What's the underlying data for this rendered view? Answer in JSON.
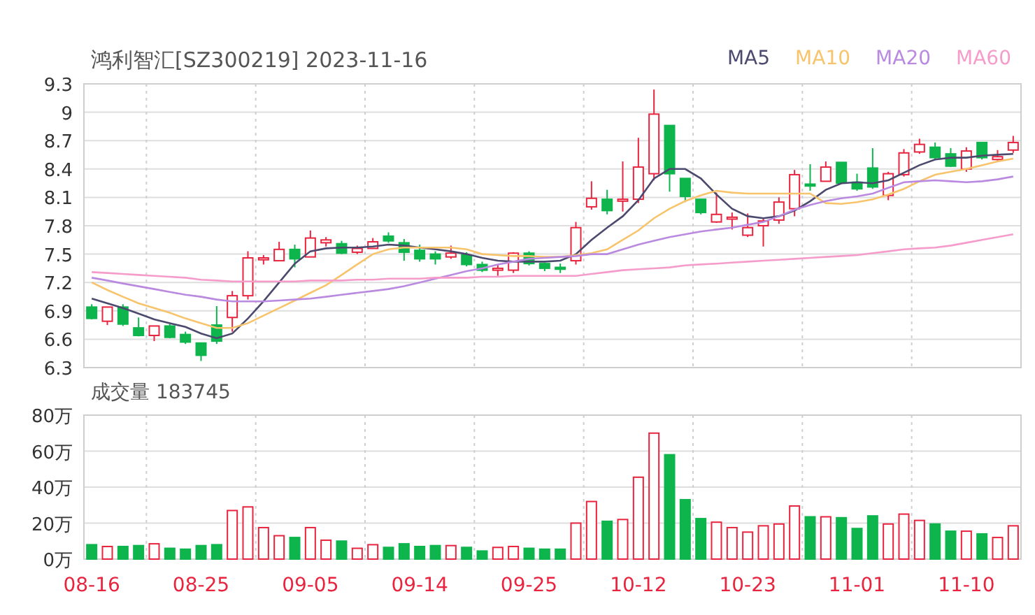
{
  "price_chart": {
    "chart_data": {
      "type": "candlestick",
      "title": "鸿利智汇[SZ300219] 2023-11-16",
      "grid": true,
      "ylim": [
        6.3,
        9.3
      ],
      "yticks": [
        {
          "value": 9.3,
          "label": "9.3"
        },
        {
          "value": 9,
          "label": "9"
        },
        {
          "value": 8.7,
          "label": "8.7"
        },
        {
          "value": 8.4,
          "label": "8.4"
        },
        {
          "value": 8.1,
          "label": "8.1"
        },
        {
          "value": 7.8,
          "label": "7.8"
        },
        {
          "value": 7.5,
          "label": "7.5"
        },
        {
          "value": 7.2,
          "label": "7.2"
        },
        {
          "value": 6.9,
          "label": "6.9"
        },
        {
          "value": 6.6,
          "label": "6.6"
        },
        {
          "value": 6.3,
          "label": "6.3"
        }
      ],
      "categories": [
        null,
        null,
        null,
        null,
        null,
        null,
        null,
        null,
        null,
        null,
        null,
        null,
        null,
        null,
        null,
        null,
        null,
        null,
        null,
        null,
        null,
        null,
        null,
        null,
        null,
        null,
        null,
        null,
        null,
        null,
        null,
        null,
        null,
        null,
        null,
        null,
        null,
        null,
        null,
        null,
        null,
        null,
        null,
        null,
        null,
        null,
        null,
        null,
        null,
        null,
        null,
        null,
        null,
        null,
        null,
        null,
        null,
        null,
        null,
        null
      ],
      "ohlc": [
        [
          6.94,
          6.97,
          6.81,
          6.82
        ],
        [
          6.79,
          6.94,
          6.75,
          6.94
        ],
        [
          6.94,
          6.97,
          6.74,
          6.76
        ],
        [
          6.72,
          6.83,
          6.63,
          6.64
        ],
        [
          6.64,
          6.74,
          6.58,
          6.74
        ],
        [
          6.74,
          6.76,
          6.61,
          6.62
        ],
        [
          6.65,
          6.68,
          6.55,
          6.57
        ],
        [
          6.56,
          6.56,
          6.37,
          6.43
        ],
        [
          6.75,
          6.95,
          6.55,
          6.58
        ],
        [
          6.83,
          7.11,
          6.68,
          7.06
        ],
        [
          7.06,
          7.53,
          7.02,
          7.46
        ],
        [
          7.44,
          7.49,
          7.39,
          7.46
        ],
        [
          7.43,
          7.63,
          7.43,
          7.55
        ],
        [
          7.55,
          7.6,
          7.36,
          7.45
        ],
        [
          7.47,
          7.75,
          7.47,
          7.67
        ],
        [
          7.62,
          7.68,
          7.58,
          7.65
        ],
        [
          7.61,
          7.64,
          7.5,
          7.51
        ],
        [
          7.52,
          7.59,
          7.5,
          7.56
        ],
        [
          7.56,
          7.67,
          7.56,
          7.63
        ],
        [
          7.69,
          7.73,
          7.62,
          7.64
        ],
        [
          7.62,
          7.66,
          7.43,
          7.52
        ],
        [
          7.54,
          7.6,
          7.42,
          7.45
        ],
        [
          7.5,
          7.53,
          7.39,
          7.45
        ],
        [
          7.47,
          7.59,
          7.45,
          7.51
        ],
        [
          7.49,
          7.52,
          7.37,
          7.39
        ],
        [
          7.39,
          7.42,
          7.31,
          7.33
        ],
        [
          7.33,
          7.39,
          7.27,
          7.35
        ],
        [
          7.33,
          7.52,
          7.3,
          7.51
        ],
        [
          7.51,
          7.53,
          7.38,
          7.4
        ],
        [
          7.4,
          7.41,
          7.32,
          7.35
        ],
        [
          7.36,
          7.4,
          7.3,
          7.34
        ],
        [
          7.43,
          7.84,
          7.39,
          7.78
        ],
        [
          8.0,
          8.27,
          7.97,
          8.09
        ],
        [
          8.08,
          8.18,
          7.92,
          7.96
        ],
        [
          8.06,
          8.48,
          7.95,
          8.08
        ],
        [
          8.08,
          8.73,
          8.04,
          8.42
        ],
        [
          8.35,
          9.24,
          8.28,
          8.98
        ],
        [
          8.86,
          8.86,
          8.16,
          8.35
        ],
        [
          8.3,
          8.3,
          8.05,
          8.11
        ],
        [
          8.08,
          8.08,
          7.92,
          7.94
        ],
        [
          7.84,
          8.15,
          7.83,
          7.92
        ],
        [
          7.87,
          7.94,
          7.76,
          7.89
        ],
        [
          7.7,
          7.93,
          7.68,
          7.78
        ],
        [
          7.8,
          7.88,
          7.58,
          7.85
        ],
        [
          7.86,
          8.1,
          7.82,
          8.05
        ],
        [
          7.98,
          8.39,
          7.9,
          8.34
        ],
        [
          8.24,
          8.45,
          8.17,
          8.22
        ],
        [
          8.27,
          8.48,
          8.27,
          8.42
        ],
        [
          8.47,
          8.47,
          8.24,
          8.25
        ],
        [
          8.26,
          8.35,
          8.17,
          8.19
        ],
        [
          8.41,
          8.62,
          8.19,
          8.21
        ],
        [
          8.12,
          8.37,
          8.07,
          8.35
        ],
        [
          8.34,
          8.61,
          8.32,
          8.57
        ],
        [
          8.58,
          8.72,
          8.56,
          8.66
        ],
        [
          8.63,
          8.68,
          8.5,
          8.52
        ],
        [
          8.56,
          8.62,
          8.42,
          8.43
        ],
        [
          8.4,
          8.63,
          8.37,
          8.59
        ],
        [
          8.68,
          8.68,
          8.5,
          8.52
        ],
        [
          8.5,
          8.6,
          8.49,
          8.53
        ],
        [
          8.6,
          8.75,
          8.57,
          8.68
        ]
      ],
      "series": [
        {
          "name": "MA5",
          "type": "line",
          "color": "#4b4a6e",
          "values": [
            7.03,
            6.98,
            6.93,
            6.87,
            6.81,
            6.77,
            6.73,
            6.66,
            6.61,
            6.66,
            6.82,
            7.0,
            7.2,
            7.4,
            7.53,
            7.56,
            7.57,
            7.57,
            7.58,
            7.6,
            7.59,
            7.57,
            7.55,
            7.53,
            7.5,
            7.46,
            7.43,
            7.42,
            7.42,
            7.42,
            7.43,
            7.5,
            7.65,
            7.78,
            7.9,
            8.07,
            8.3,
            8.4,
            8.4,
            8.3,
            8.13,
            7.98,
            7.9,
            7.88,
            7.9,
            7.96,
            8.06,
            8.18,
            8.25,
            8.26,
            8.25,
            8.28,
            8.36,
            8.44,
            8.5,
            8.52,
            8.52,
            8.54,
            8.55,
            8.56
          ]
        },
        {
          "name": "MA10",
          "type": "line",
          "color": "#f7c46c",
          "values": [
            7.2,
            7.12,
            7.05,
            6.98,
            6.93,
            6.88,
            6.82,
            6.77,
            6.72,
            6.72,
            6.77,
            6.85,
            6.93,
            7.01,
            7.09,
            7.17,
            7.28,
            7.39,
            7.5,
            7.55,
            7.57,
            7.57,
            7.57,
            7.57,
            7.55,
            7.5,
            7.49,
            7.48,
            7.48,
            7.47,
            7.47,
            7.49,
            7.51,
            7.55,
            7.65,
            7.75,
            7.88,
            7.98,
            8.06,
            8.12,
            8.17,
            8.15,
            8.14,
            8.14,
            8.14,
            8.14,
            8.14,
            8.04,
            8.03,
            8.05,
            8.08,
            8.13,
            8.19,
            8.27,
            8.34,
            8.37,
            8.4,
            8.44,
            8.48,
            8.51
          ]
        },
        {
          "name": "MA20",
          "type": "line",
          "color": "#b98ae0",
          "values": [
            7.25,
            7.22,
            7.19,
            7.16,
            7.13,
            7.1,
            7.07,
            7.05,
            7.02,
            7.0,
            7.0,
            7.0,
            7.01,
            7.02,
            7.03,
            7.05,
            7.07,
            7.09,
            7.11,
            7.13,
            7.16,
            7.2,
            7.24,
            7.28,
            7.32,
            7.35,
            7.39,
            7.42,
            7.45,
            7.46,
            7.47,
            7.48,
            7.5,
            7.5,
            7.55,
            7.6,
            7.64,
            7.68,
            7.71,
            7.74,
            7.76,
            7.78,
            7.81,
            7.84,
            7.9,
            7.97,
            8.02,
            8.06,
            8.09,
            8.11,
            8.14,
            8.2,
            8.26,
            8.27,
            8.28,
            8.27,
            8.26,
            8.27,
            8.29,
            8.32
          ]
        },
        {
          "name": "MA60",
          "type": "line",
          "color": "#f59ccb",
          "values": [
            7.31,
            7.3,
            7.29,
            7.28,
            7.27,
            7.26,
            7.25,
            7.23,
            7.22,
            7.21,
            7.21,
            7.21,
            7.21,
            7.21,
            7.22,
            7.22,
            7.22,
            7.23,
            7.23,
            7.24,
            7.24,
            7.24,
            7.25,
            7.25,
            7.25,
            7.26,
            7.26,
            7.27,
            7.27,
            7.27,
            7.27,
            7.27,
            7.29,
            7.31,
            7.33,
            7.34,
            7.35,
            7.36,
            7.38,
            7.39,
            7.4,
            7.41,
            7.42,
            7.43,
            7.44,
            7.45,
            7.46,
            7.47,
            7.48,
            7.49,
            7.51,
            7.53,
            7.55,
            7.56,
            7.57,
            7.59,
            7.62,
            7.65,
            7.68,
            7.71
          ]
        }
      ]
    }
  },
  "volume_chart": {
    "chart_data": {
      "type": "bar",
      "title": "成交量 183745",
      "grid": true,
      "ylim": [
        0,
        80
      ],
      "yticks": [
        {
          "value": 80,
          "label": "80万"
        },
        {
          "value": 60,
          "label": "60万"
        },
        {
          "value": 40,
          "label": "40万"
        },
        {
          "value": 20,
          "label": "20万"
        },
        {
          "value": 0,
          "label": "0万"
        }
      ],
      "categories": [
        "08-16",
        null,
        null,
        null,
        null,
        null,
        null,
        "08-25",
        null,
        null,
        null,
        null,
        null,
        null,
        "09-05",
        null,
        null,
        null,
        null,
        null,
        null,
        "09-14",
        null,
        null,
        null,
        null,
        null,
        null,
        "09-25",
        null,
        null,
        null,
        null,
        null,
        null,
        "10-12",
        null,
        null,
        null,
        null,
        null,
        null,
        "10-23",
        null,
        null,
        null,
        null,
        null,
        null,
        "11-01",
        null,
        null,
        null,
        null,
        null,
        null,
        "11-10",
        null,
        null,
        null
      ],
      "values": [
        8,
        7,
        7,
        7.5,
        8.5,
        6,
        5.5,
        7.5,
        8,
        27,
        29,
        17.5,
        13,
        12,
        17.5,
        10.5,
        10,
        6,
        8,
        6.5,
        8.5,
        7,
        7.5,
        7.5,
        6.5,
        4.5,
        6.5,
        7,
        6,
        5.5,
        5.5,
        20,
        32,
        21,
        22,
        45.5,
        70,
        58,
        33,
        22.5,
        20.5,
        17.5,
        15,
        18.5,
        19.5,
        29.5,
        23.5,
        23.5,
        23,
        17,
        24,
        19.5,
        25,
        21.5,
        19.5,
        15.5,
        15.5,
        14,
        12,
        18.5
      ]
    }
  }
}
